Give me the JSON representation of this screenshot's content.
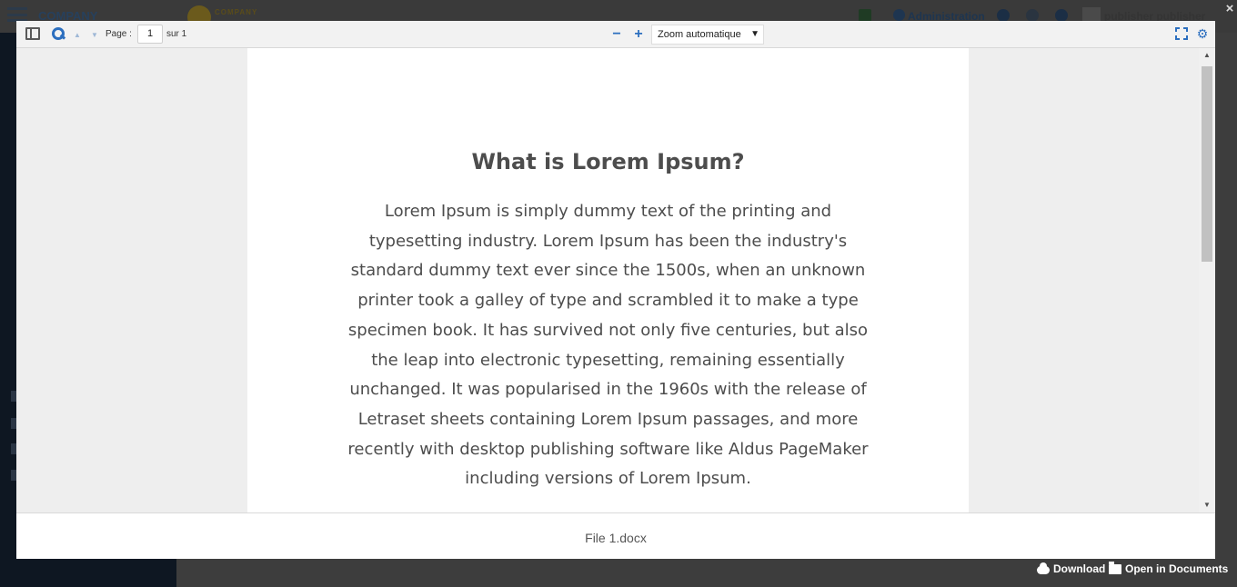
{
  "background_app": {
    "company_name": "COMPANY",
    "logo_text": "COMPANY",
    "admin_label": "Administration",
    "user_name": "publisher publisher"
  },
  "viewer": {
    "toolbar": {
      "page_label": "Page :",
      "page_value": "1",
      "page_of": "sur 1",
      "zoom_out": "−",
      "zoom_in": "+",
      "zoom_selected": "Zoom automatique",
      "zoom_caret": "▼",
      "arrow_up": "▲",
      "arrow_down": "▼",
      "tools_glyph": "⚙"
    },
    "document": {
      "title": "What is Lorem Ipsum?",
      "body": "Lorem Ipsum is simply dummy text of the printing and typesetting industry. Lorem Ipsum has been the industry's standard dummy text ever since the 1500s, when an unknown printer took a galley of type and scrambled it to make a type specimen book. It has survived not only five centuries, but also the leap into electronic typesetting, remaining essentially unchanged. It was popularised in the 1960s with the release of Letraset sheets containing Lorem Ipsum passages, and more recently with desktop publishing software like Aldus PageMaker including versions of Lorem Ipsum."
    },
    "footer": {
      "file_name": "File 1.docx"
    }
  },
  "actions": {
    "download_label": "Download",
    "open_in_documents_label": "Open in Documents"
  },
  "close_glyph": "×",
  "icons": [
    "sidebar-toggle-icon",
    "search-icon",
    "fullscreen-icon",
    "tools-icon",
    "cloud-download-icon",
    "folder-icon",
    "close-icon"
  ],
  "colors": {
    "accent": "#2c6fbf",
    "text": "#4d4d4d",
    "overlay": "#3b3b3b"
  }
}
